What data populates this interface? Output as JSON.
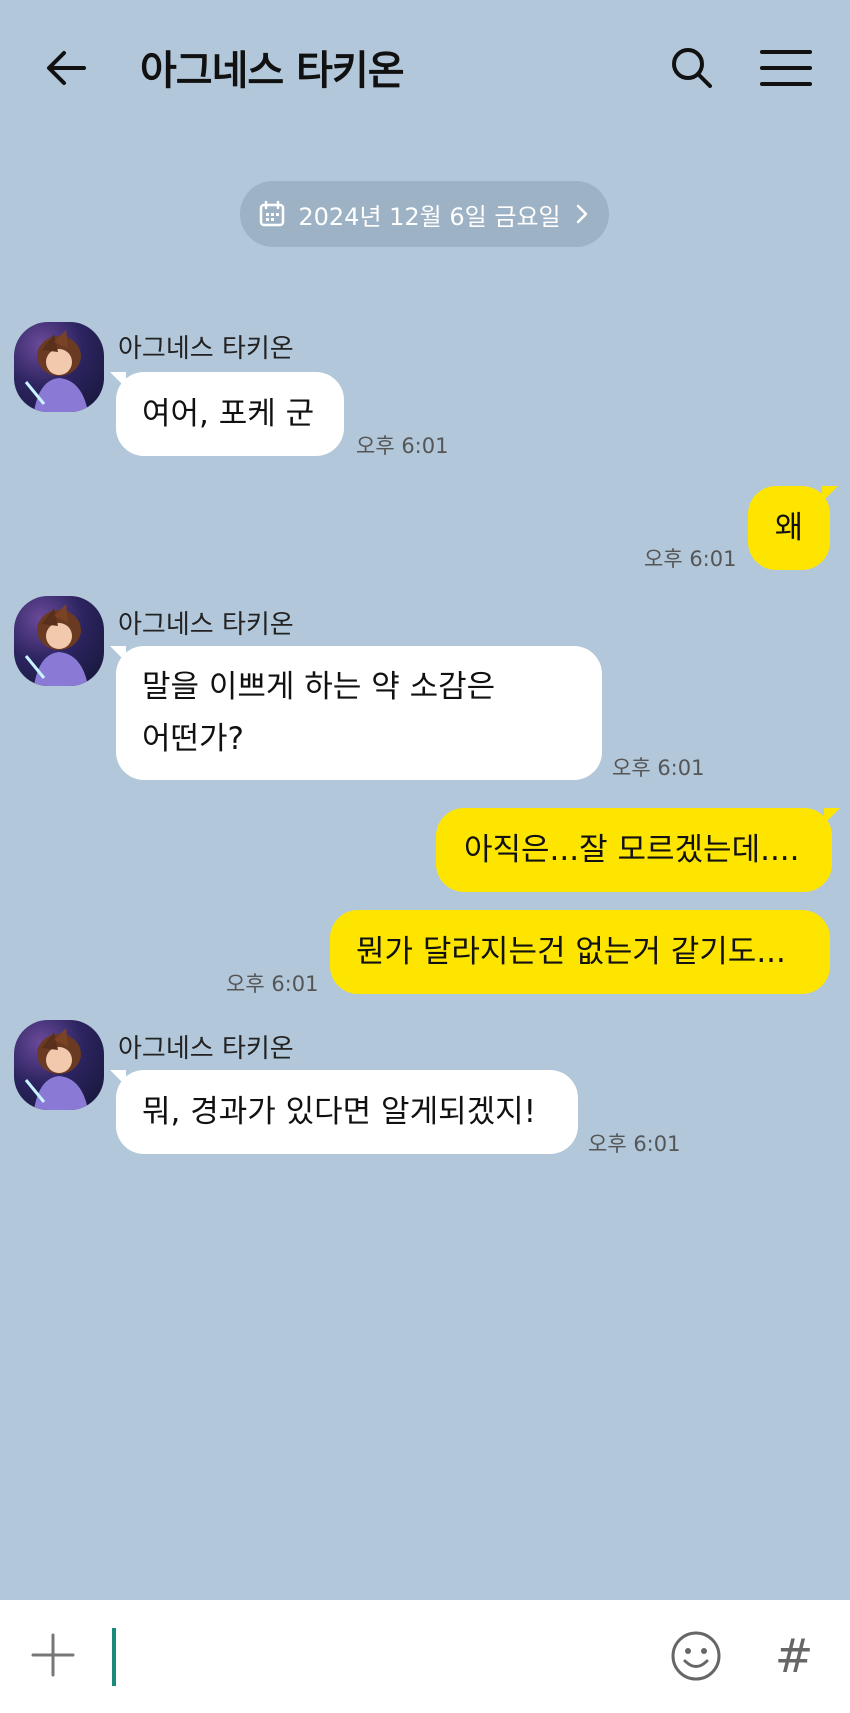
{
  "header": {
    "title": "아그네스 타키온",
    "back_icon": "arrow-left-icon",
    "search_icon": "search-icon",
    "menu_icon": "hamburger-menu-icon"
  },
  "date_divider": {
    "label": "2024년 12월 6일 금요일",
    "icon": "calendar-icon"
  },
  "messages": [
    {
      "direction": "in",
      "sender": "아그네스 타키온",
      "text": "여어, 포케 군",
      "time": "오후 6:01"
    },
    {
      "direction": "out",
      "text": "왜",
      "time": "오후 6:01"
    },
    {
      "direction": "in",
      "sender": "아그네스 타키온",
      "text": "말을 이쁘게 하는 약 소감은\n어떤가?",
      "time": "오후 6:01"
    },
    {
      "direction": "out",
      "text": "아직은...잘 모르겠는데....",
      "time": ""
    },
    {
      "direction": "out",
      "text": "뭔가 달라지는건 없는거 같기도...",
      "time": "오후 6:01"
    },
    {
      "direction": "in",
      "sender": "아그네스 타키온",
      "text": "뭐, 경과가 있다면 알게되겠지!",
      "time": "오후 6:01"
    }
  ],
  "input_bar": {
    "value": "",
    "plus_icon": "plus-icon",
    "emoji_icon": "emoji-icon",
    "hash_label": "#"
  },
  "colors": {
    "background": "#b2c7da",
    "incoming_bubble": "#ffffff",
    "outgoing_bubble": "#fee500",
    "caret": "#1a8a7a"
  }
}
